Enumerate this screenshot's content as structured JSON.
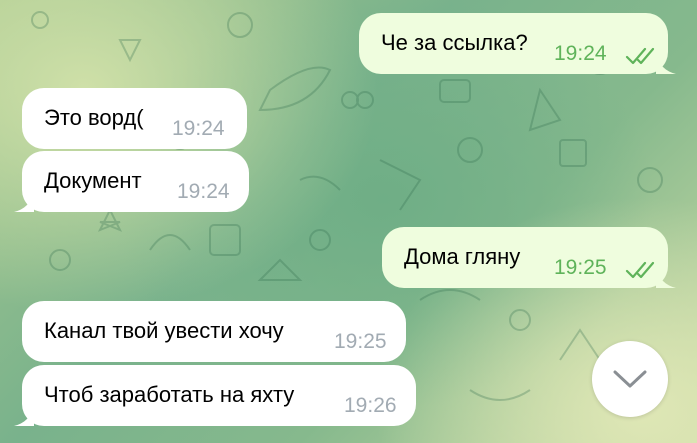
{
  "messages": [
    {
      "direction": "outgoing",
      "text": "Че за ссылка?",
      "time": "19:24",
      "status": "read-double-check"
    },
    {
      "direction": "incoming",
      "text": "Это ворд(",
      "time": "19:24"
    },
    {
      "direction": "incoming",
      "text": "Документ",
      "time": "19:24"
    },
    {
      "direction": "outgoing",
      "text": "Дома гляну",
      "time": "19:25",
      "status": "read-double-check"
    },
    {
      "direction": "incoming",
      "text": "Канал твой увести хочу",
      "time": "19:25"
    },
    {
      "direction": "incoming",
      "text": "Чтоб заработать на яхту",
      "time": "19:26"
    }
  ],
  "scroll_button": {
    "icon": "chevron-down-icon"
  },
  "colors": {
    "incoming_bubble": "#ffffff",
    "outgoing_bubble": "#effdde",
    "time_incoming": "#a2abb3",
    "time_outgoing": "#5fb35a"
  }
}
